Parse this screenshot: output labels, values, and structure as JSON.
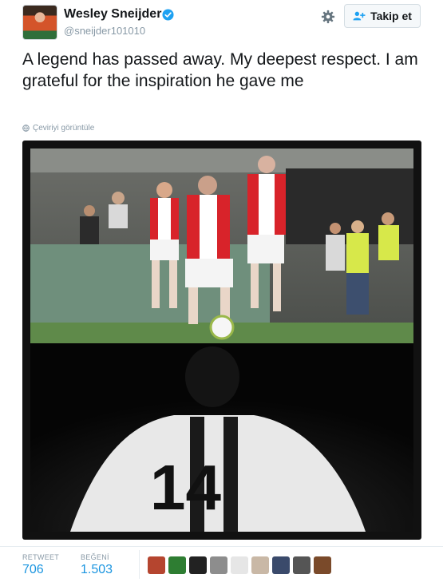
{
  "user": {
    "name": "Wesley Sneijder",
    "handle": "@sneijder101010",
    "verified_icon": "verified-badge-icon"
  },
  "actions": {
    "settings_icon": "gear-icon",
    "follow_label": "Takip et",
    "follow_icon": "add-user-icon"
  },
  "tweet": {
    "text": "A legend has passed away. My deepest respect.  I am grateful for the inspiration he gave me",
    "translate_label": "Çeviriyi görüntüle",
    "translate_icon": "globe-icon"
  },
  "media": {
    "top_photo_icon": "football-match-photo",
    "bottom_photo_icon": "black-and-white-jersey-photo",
    "jersey_number": "14"
  },
  "stats": {
    "retweet_label": "RETWEET",
    "retweet_count": "706",
    "like_label": "BEĞENİ",
    "like_count": "1.503"
  },
  "likers": [
    {
      "color": "#b5452f"
    },
    {
      "color": "#2e7d32"
    },
    {
      "color": "#222222"
    },
    {
      "color": "#8d8d8d"
    },
    {
      "color": "#e6e6e6"
    },
    {
      "color": "#c9b8a6"
    },
    {
      "color": "#3a4a6b"
    },
    {
      "color": "#555555"
    },
    {
      "color": "#7a4a2a"
    }
  ],
  "colors": {
    "accent": "#1b95e0",
    "verified": "#1da1f2"
  }
}
